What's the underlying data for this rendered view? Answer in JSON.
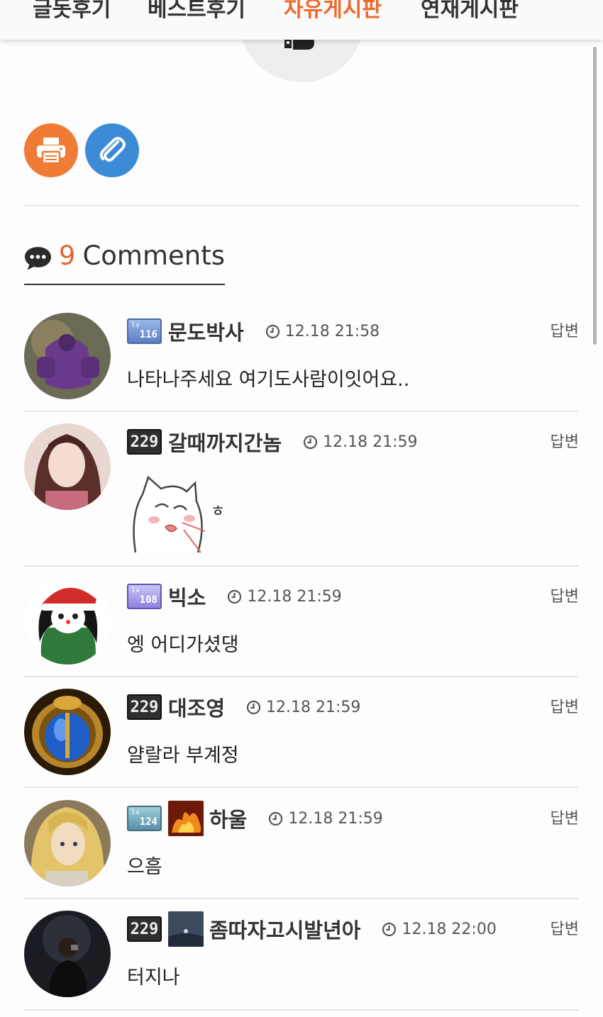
{
  "nav": {
    "items": [
      "글돗후기",
      "베스트후기",
      "자유게시판",
      "연재게시판"
    ],
    "active_index": 2
  },
  "actions": {
    "print_icon": "print-icon",
    "attach_icon": "paperclip-icon"
  },
  "comments_header": {
    "count": "9",
    "label": "Comments",
    "icon": "speech-bubble-icon"
  },
  "colors": {
    "accent": "#ec6a2c",
    "print_button": "#ef7b34",
    "attach_button": "#3b8bd6"
  },
  "comments": [
    {
      "level": "116",
      "level_badge": "lv-badge-blue",
      "nickname": "문도박사",
      "time": "12.18 21:58",
      "reply": "답변",
      "text": "나타나주세요 여기도사람이잇어요.."
    },
    {
      "level": "229",
      "level_badge": "lv-badge-dark",
      "nickname": "갈때까지간놈",
      "time": "12.18 21:59",
      "reply": "답변",
      "text": "ㅎ",
      "has_sticker": true
    },
    {
      "level": "108",
      "level_badge": "lv-badge-purple",
      "nickname": "빅소",
      "time": "12.18 21:59",
      "reply": "답변",
      "text": "엥 어디가셨댕"
    },
    {
      "level": "229",
      "level_badge": "lv-badge-dark",
      "nickname": "대조영",
      "time": "12.18 21:59",
      "reply": "답변",
      "text": "얄랄라 부계정"
    },
    {
      "level": "124",
      "level_badge": "lv-badge-teal",
      "nickname": "하울",
      "time": "12.18 21:59",
      "reply": "답변",
      "text": "으흠",
      "icon": "fire-castle-icon"
    },
    {
      "level": "229",
      "level_badge": "lv-badge-dark",
      "nickname": "좀따자고시발년아",
      "time": "12.18 22:00",
      "reply": "답변",
      "text": "터지나",
      "icon": "dark-sky-icon"
    }
  ]
}
